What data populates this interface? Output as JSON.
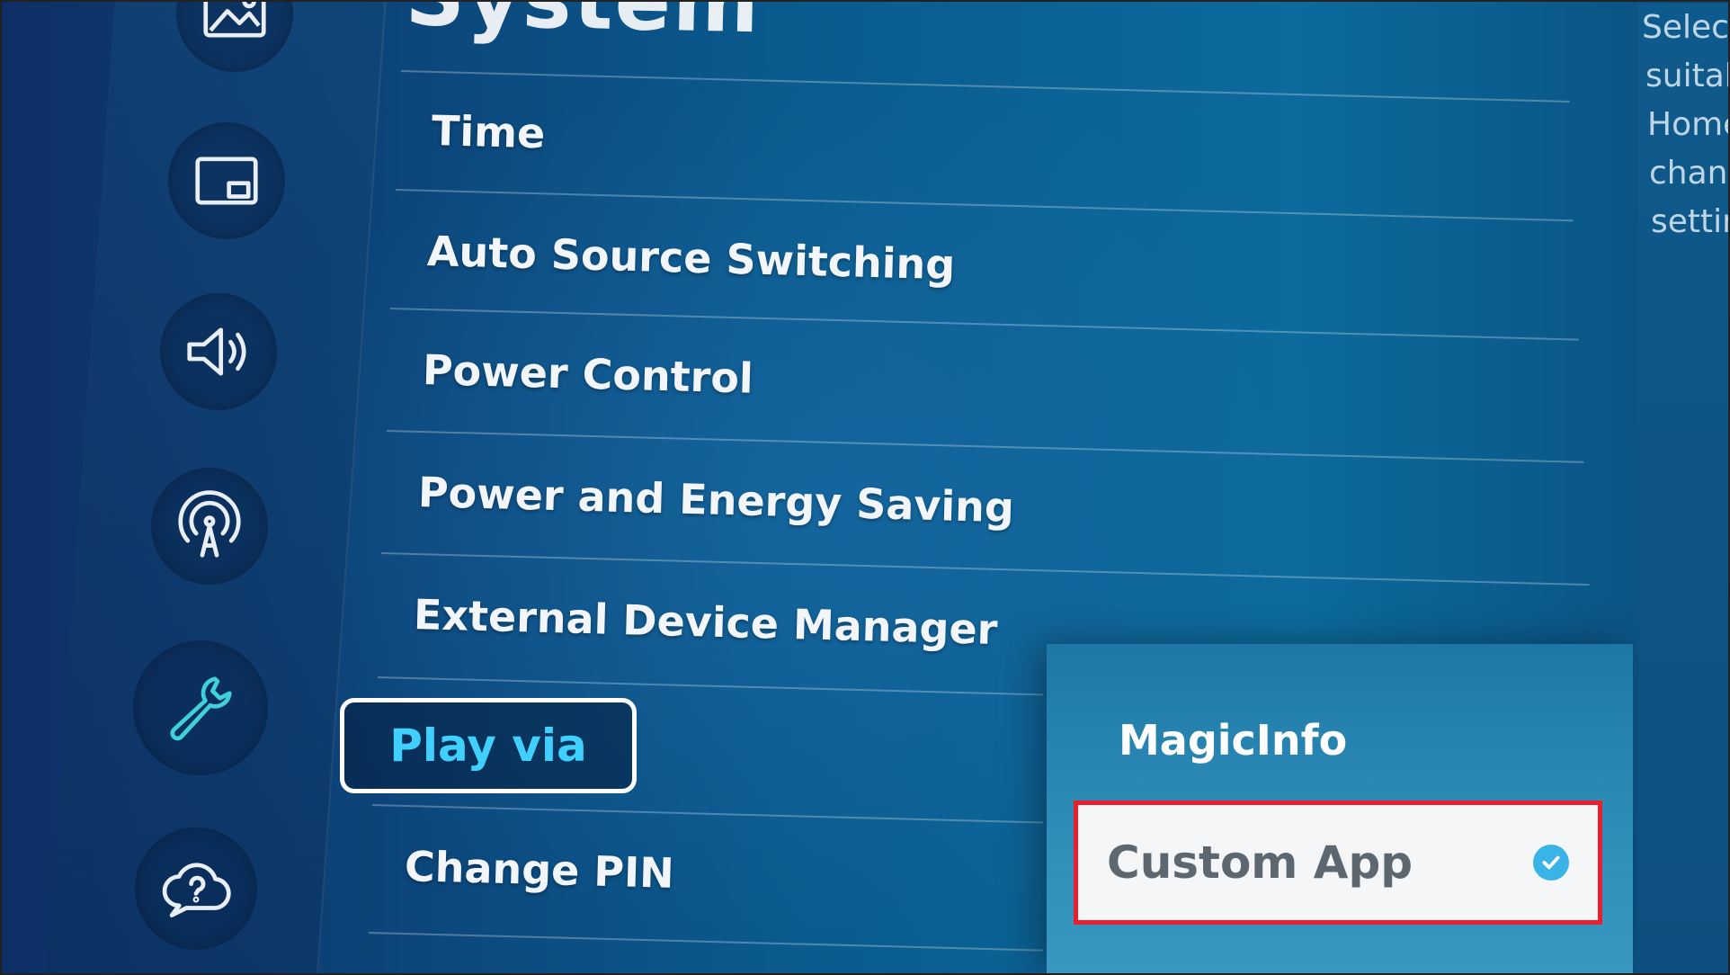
{
  "page": {
    "title": "System"
  },
  "sidebar": {
    "icons": [
      {
        "name": "picture-icon"
      },
      {
        "name": "picture-in-picture-icon"
      },
      {
        "name": "sound-icon"
      },
      {
        "name": "broadcast-icon"
      },
      {
        "name": "wrench-icon"
      },
      {
        "name": "support-icon"
      }
    ],
    "active_color": "#3fd0d8"
  },
  "menu": {
    "items": [
      {
        "label": "Time"
      },
      {
        "label": "Auto Source Switching"
      },
      {
        "label": "Power Control"
      },
      {
        "label": "Power and Energy Saving"
      },
      {
        "label": "External Device Manager"
      },
      {
        "label": "Play via"
      },
      {
        "label": "Change PIN"
      }
    ],
    "focused_color": "#3fd0ff"
  },
  "dropdown": {
    "options": [
      {
        "label": "MagicInfo",
        "selected": false
      },
      {
        "label": "Custom App",
        "selected": true
      }
    ],
    "highlight_color": "#e8202e"
  },
  "description": {
    "lines": [
      "Select",
      "suitab",
      "Home",
      "chang",
      "settir"
    ]
  }
}
